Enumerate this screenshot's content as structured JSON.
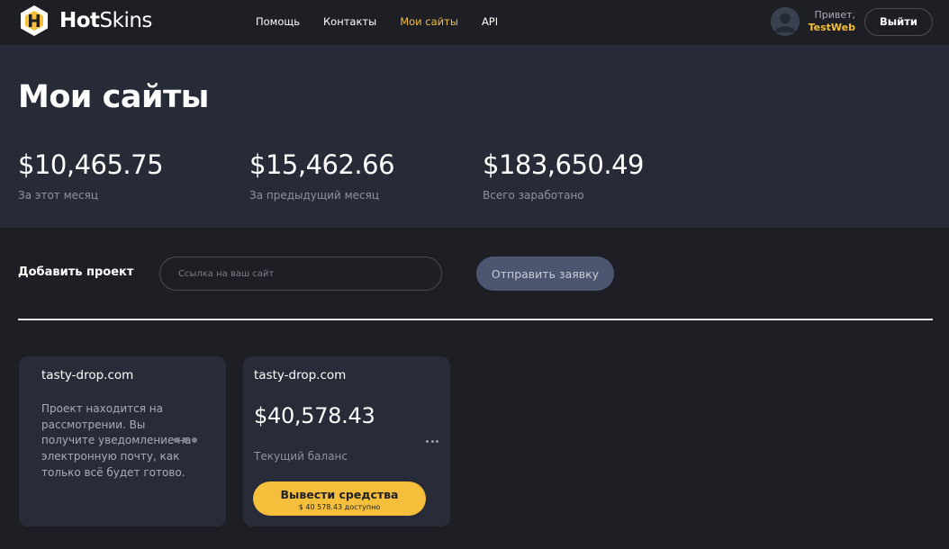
{
  "brand": {
    "name_bold": "Hot",
    "name_rest": "Skins",
    "accent": "#f5bf3b",
    "logo_letter": "H"
  },
  "nav": [
    {
      "label": "Помощь",
      "active": false
    },
    {
      "label": "Контакты",
      "active": false
    },
    {
      "label": "Мои сайты",
      "active": true
    },
    {
      "label": "API",
      "active": false
    }
  ],
  "user": {
    "greeting": "Привет,",
    "name": "TestWeb",
    "logout_label": "Выйти",
    "avatar_icon": "user-avatar-icon"
  },
  "hero": {
    "title": "Мои сайты",
    "stats": [
      {
        "value": "$10,465.75",
        "label": "За этот месяц"
      },
      {
        "value": "$15,462.66",
        "label": "За предыдущий месяц"
      },
      {
        "value": "$183,650.49",
        "label": "Всего заработано"
      }
    ]
  },
  "add_project": {
    "label": "Добавить проект",
    "placeholder": "Ссылка на ваш сайт",
    "value": "",
    "submit_label": "Отправить заявку"
  },
  "sites": [
    {
      "domain": "tasty-drop.com",
      "status": "pending",
      "message": "Проект находится на рассмотрении. Вы получите уведомление на электронную почту, как только всё будет готово.",
      "status_icon": "loading-dots-icon"
    },
    {
      "domain": "tasty-drop.com",
      "status": "active",
      "balance": "$40,578.43",
      "balance_label": "Текущий баланс",
      "withdraw_label": "Вывести средства",
      "withdraw_sub": "$ 40 578.43 доступно",
      "menu_icon": "more-horizontal-icon"
    }
  ]
}
